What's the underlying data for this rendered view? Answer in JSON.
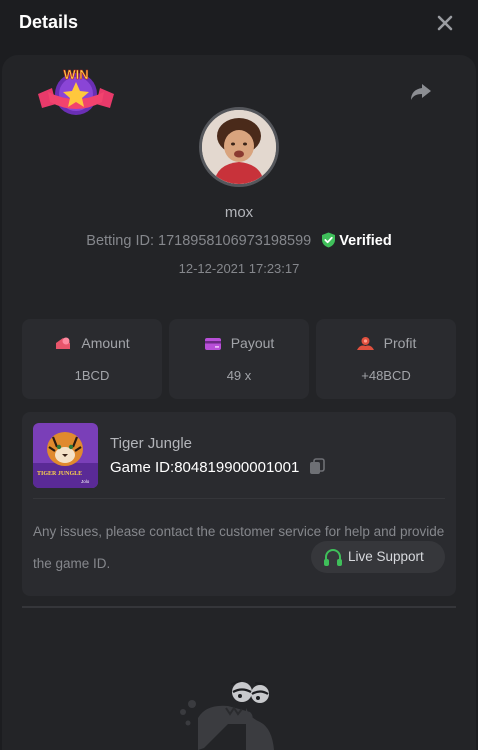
{
  "header": {
    "title": "Details"
  },
  "icons": {
    "close": "close-icon",
    "share": "share-icon",
    "verified": "verified-shield-icon",
    "copy": "copy-icon",
    "headset": "headset-icon",
    "amount": "amount-icon",
    "payout": "payout-icon",
    "profit": "profit-icon"
  },
  "badge": {
    "text": "WIN"
  },
  "player": {
    "username": "mox",
    "bet_label": "Betting ID: ",
    "bet_id": "1718958106973198599",
    "verified_label": "Verified",
    "timestamp": "12-12-2021 17:23:17"
  },
  "stats": {
    "amount": {
      "label": "Amount",
      "value": "1BCD"
    },
    "payout": {
      "label": "Payout",
      "value": "49 x"
    },
    "profit": {
      "label": "Profit",
      "value": "+48BCD"
    }
  },
  "game": {
    "name": "Tiger Jungle",
    "id_label": "Game ID:",
    "id": "804819900001001",
    "thumb_title": "TIGER JUNGLE",
    "thumb_brand": "Jolo"
  },
  "support": {
    "message": "Any issues, please contact the customer service for help and provide the game ID.",
    "button_label": "Live Support"
  },
  "colors": {
    "background": "#1c1d20",
    "card": "#232427",
    "tile": "#2a2b2f",
    "verified_green": "#3fbf5a",
    "amount_icon": "#e8556b",
    "payout_icon": "#b84fd8",
    "profit_icon": "#e0503e",
    "headset_green": "#3fbf5a"
  }
}
